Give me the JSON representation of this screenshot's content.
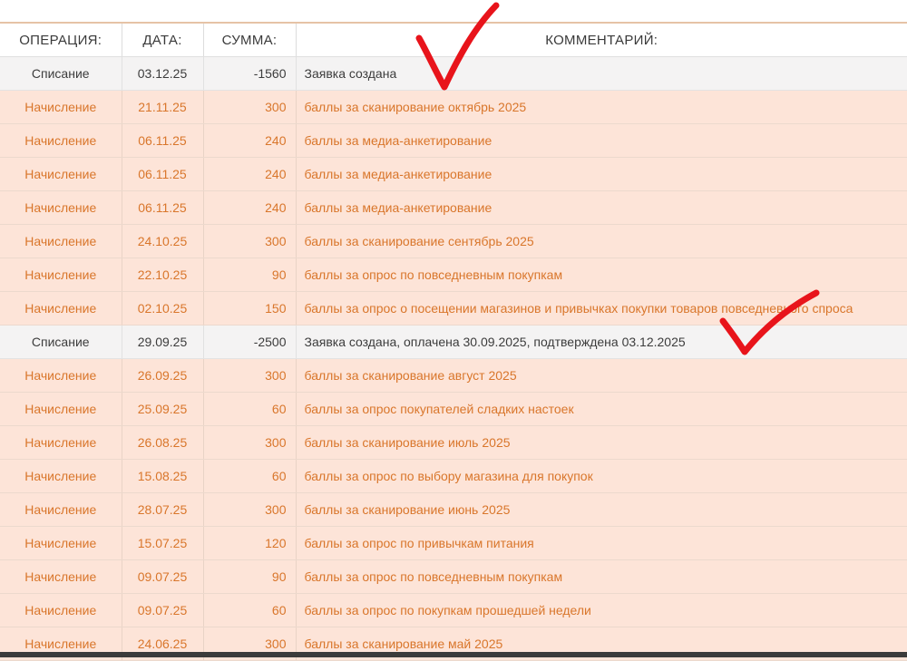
{
  "table": {
    "headers": {
      "operation": "ОПЕРАЦИЯ:",
      "date": "ДАТА:",
      "sum": "СУММА:",
      "comment": "КОММЕНТАРИЙ:"
    },
    "rows": [
      {
        "type": "writeoff",
        "operation": "Списание",
        "date": "03.12.25",
        "sum": "-1560",
        "comment": "Заявка создана"
      },
      {
        "type": "accrual",
        "operation": "Начисление",
        "date": "21.11.25",
        "sum": "300",
        "comment": "баллы за сканирование октябрь 2025"
      },
      {
        "type": "accrual",
        "operation": "Начисление",
        "date": "06.11.25",
        "sum": "240",
        "comment": "баллы за медиа-анкетирование"
      },
      {
        "type": "accrual",
        "operation": "Начисление",
        "date": "06.11.25",
        "sum": "240",
        "comment": "баллы за медиа-анкетирование"
      },
      {
        "type": "accrual",
        "operation": "Начисление",
        "date": "06.11.25",
        "sum": "240",
        "comment": "баллы за медиа-анкетирование"
      },
      {
        "type": "accrual",
        "operation": "Начисление",
        "date": "24.10.25",
        "sum": "300",
        "comment": "баллы за сканирование сентябрь 2025"
      },
      {
        "type": "accrual",
        "operation": "Начисление",
        "date": "22.10.25",
        "sum": "90",
        "comment": "баллы за опрос по повседневным покупкам"
      },
      {
        "type": "accrual",
        "operation": "Начисление",
        "date": "02.10.25",
        "sum": "150",
        "comment": "баллы за опрос о посещении магазинов и привычках покупки товаров повседневного спроса"
      },
      {
        "type": "writeoff",
        "operation": "Списание",
        "date": "29.09.25",
        "sum": "-2500",
        "comment": "Заявка создана, оплачена 30.09.2025, подтверждена 03.12.2025"
      },
      {
        "type": "accrual",
        "operation": "Начисление",
        "date": "26.09.25",
        "sum": "300",
        "comment": "баллы за сканирование август 2025"
      },
      {
        "type": "accrual",
        "operation": "Начисление",
        "date": "25.09.25",
        "sum": "60",
        "comment": "баллы за опрос покупателей сладких настоек"
      },
      {
        "type": "accrual",
        "operation": "Начисление",
        "date": "26.08.25",
        "sum": "300",
        "comment": "баллы за сканирование июль 2025"
      },
      {
        "type": "accrual",
        "operation": "Начисление",
        "date": "15.08.25",
        "sum": "60",
        "comment": "баллы за опрос по выбору магазина для покупок"
      },
      {
        "type": "accrual",
        "operation": "Начисление",
        "date": "28.07.25",
        "sum": "300",
        "comment": "баллы за сканирование июнь 2025"
      },
      {
        "type": "accrual",
        "operation": "Начисление",
        "date": "15.07.25",
        "sum": "120",
        "comment": "баллы за опрос по привычкам питания"
      },
      {
        "type": "accrual",
        "operation": "Начисление",
        "date": "09.07.25",
        "sum": "90",
        "comment": "баллы за опрос по повседневным покупкам"
      },
      {
        "type": "accrual",
        "operation": "Начисление",
        "date": "09.07.25",
        "sum": "60",
        "comment": "баллы за опрос по покупкам прошедшей недели"
      },
      {
        "type": "accrual",
        "operation": "Начисление",
        "date": "24.06.25",
        "sum": "300",
        "comment": "баллы за сканирование май 2025"
      }
    ]
  },
  "colors": {
    "accrual_bg": "#fde4d8",
    "accrual_text": "#d9762b",
    "writeoff_bg": "#f4f3f3",
    "writeoff_text": "#3c3c3c",
    "checkmark": "#e8141b"
  },
  "annotations": [
    "checkmark-icon",
    "checkmark-icon"
  ]
}
